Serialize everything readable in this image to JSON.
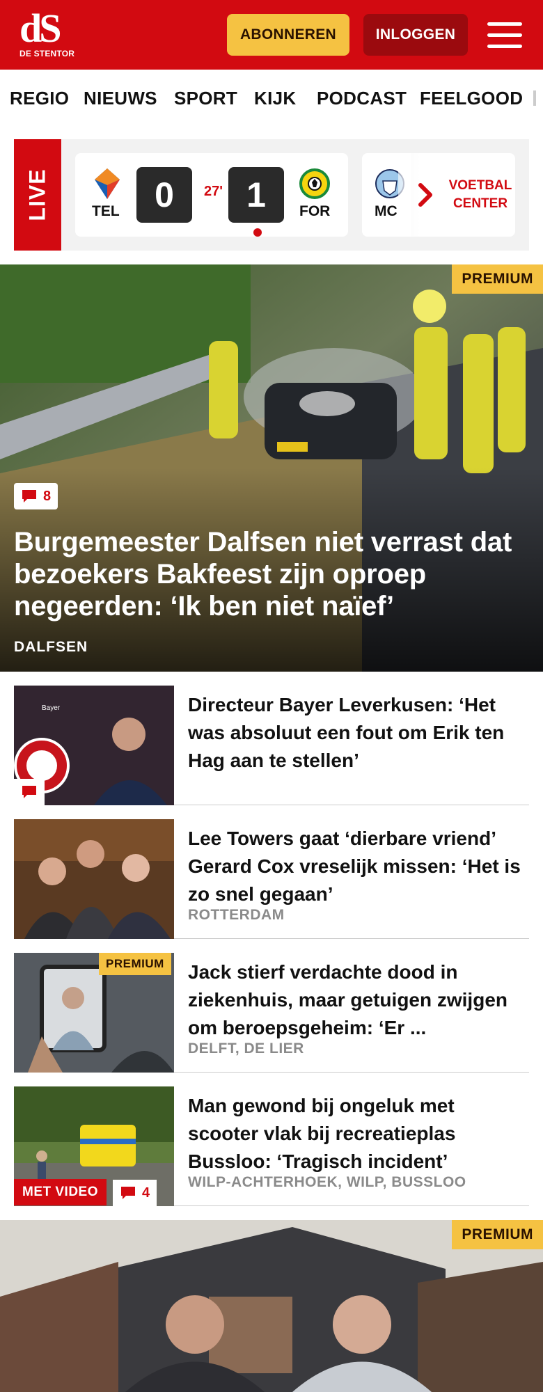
{
  "header": {
    "logo_mark": "dS",
    "logo_sub": "DE STENTOR",
    "subscribe_label": "ABONNEREN",
    "login_label": "INLOGGEN",
    "menu_icon": "hamburger-icon"
  },
  "nav": {
    "items": [
      "REGIO",
      "NIEUWS",
      "SPORT",
      "KIJK",
      "PODCAST",
      "FEELGOOD"
    ]
  },
  "live": {
    "label": "LIVE",
    "match": {
      "home_code": "TEL",
      "away_code": "FOR",
      "home_score": "0",
      "away_score": "1",
      "minute": "27'"
    },
    "next_match_code": "MC",
    "center_label_1": "VOETBAL",
    "center_label_2": "CENTER"
  },
  "hero": {
    "badge": "PREMIUM",
    "comments": "8",
    "title": "Burgemeester Dalfsen niet verrast dat bezoekers Bakfeest zijn oproep negeerden: ‘Ik ben niet naïef’",
    "location": "DALFSEN"
  },
  "articles": [
    {
      "title": "Directeur Bayer Leverkusen: ‘Het was absoluut een fout om Erik ten Hag aan te stellen’",
      "location": "",
      "comments": ""
    },
    {
      "title": "Lee Towers gaat ‘dierbare vriend’ Gerard Cox vreselijk missen: ‘Het is zo snel gegaan’",
      "location": "ROTTERDAM"
    },
    {
      "badge": "PREMIUM",
      "title": "Jack stierf verdachte dood in ziekenhuis, maar getuigen zwijgen om beroepsgeheim: ‘Er ...",
      "location": "DELFT, DE LIER"
    },
    {
      "video_label": "MET VIDEO",
      "comments": "4",
      "title": "Man gewond bij ongeluk met scooter vlak bij recreatieplas Bussloo: ‘Tragisch incident’",
      "location": "WILP-ACHTERHOEK, WILP, BUSSLOO"
    }
  ],
  "bottom_hero": {
    "badge": "PREMIUM"
  },
  "colors": {
    "brand_red": "#d20a11",
    "premium_yellow": "#f5c242",
    "login_dark_red": "#9b0a0e"
  }
}
